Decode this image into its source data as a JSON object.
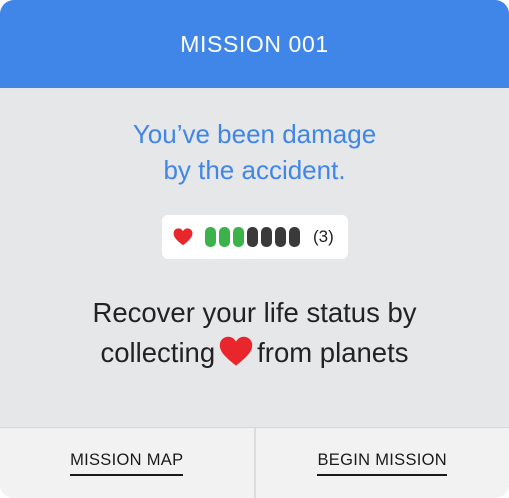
{
  "header": {
    "title": "MISSION 001"
  },
  "message": {
    "line1": "You’ve been damage",
    "line2": "by the accident."
  },
  "life_status": {
    "icon": "heart-icon",
    "segments_total": 7,
    "segments_filled": 3,
    "count_label": "(3)"
  },
  "instruction": {
    "line1": "Recover your life status by",
    "line2_before": "collecting",
    "line2_icon": "heart-icon",
    "line2_after": "from planets"
  },
  "footer": {
    "mission_map_label": "MISSION MAP",
    "begin_mission_label": "BEGIN MISSION"
  },
  "colors": {
    "accent_blue": "#3f86e8",
    "heart_red": "#e8262b",
    "life_green": "#3cb34a",
    "life_empty": "#3a3a3a",
    "panel_gray": "#e6e7e9"
  }
}
